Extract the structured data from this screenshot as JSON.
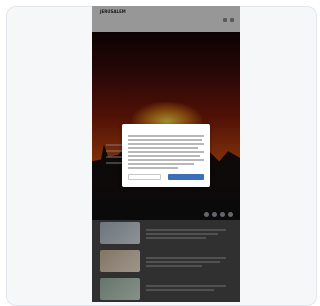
{
  "site": {
    "logo": "JERUSALEM",
    "top_links": [
      "",
      "",
      ""
    ],
    "nav": [
      "",
      "",
      "",
      "",
      "",
      "",
      ""
    ]
  },
  "articles": [
    {
      "title": ""
    },
    {
      "title": ""
    },
    {
      "title": ""
    }
  ],
  "consent_modal": {
    "title": "",
    "secondary_button": "",
    "primary_button": "",
    "links": [
      "",
      ""
    ]
  }
}
